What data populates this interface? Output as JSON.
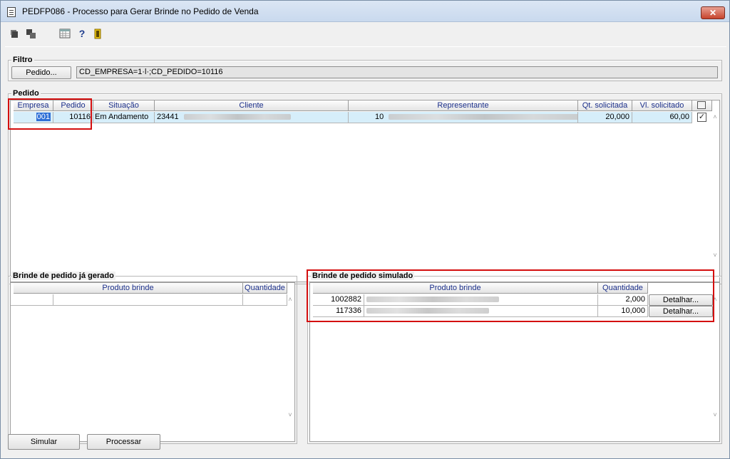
{
  "window": {
    "title": "PEDFP086 - Processo para Gerar Brinde no Pedido de Venda",
    "close_label": "✕"
  },
  "toolbar": {
    "help_glyph": "?"
  },
  "filtro": {
    "label": "Filtro",
    "pedido_button": "Pedido...",
    "filter_value": "CD_EMPRESA=1·l·;CD_PEDIDO=10116"
  },
  "pedido": {
    "label": "Pedido",
    "columns": [
      "Empresa",
      "Pedido",
      "Situação",
      "Cliente",
      "Representante",
      "Qt. solicitada",
      "Vl. solicitado"
    ],
    "row": {
      "empresa": "001",
      "pedido": "10116",
      "situacao": "Em Andamento",
      "cliente_code": "23441",
      "representante_code": "10",
      "qt_solicitada": "20,000",
      "vl_solicitado": "60,00",
      "checked": "✓"
    }
  },
  "brinde_gerado": {
    "label": "Brinde de pedido já gerado",
    "columns": [
      "Produto brinde",
      "Quantidade"
    ]
  },
  "brinde_simulado": {
    "label": "Brinde de pedido simulado",
    "columns": [
      "Produto brinde",
      "Quantidade"
    ],
    "rows": [
      {
        "code": "1002882",
        "quantidade": "2,000",
        "action": "Detalhar..."
      },
      {
        "code": "117336",
        "quantidade": "10,000",
        "action": "Detalhar..."
      }
    ]
  },
  "footer": {
    "simular": "Simular",
    "processar": "Processar"
  },
  "scroll": {
    "up": "˄",
    "down": "˅"
  }
}
